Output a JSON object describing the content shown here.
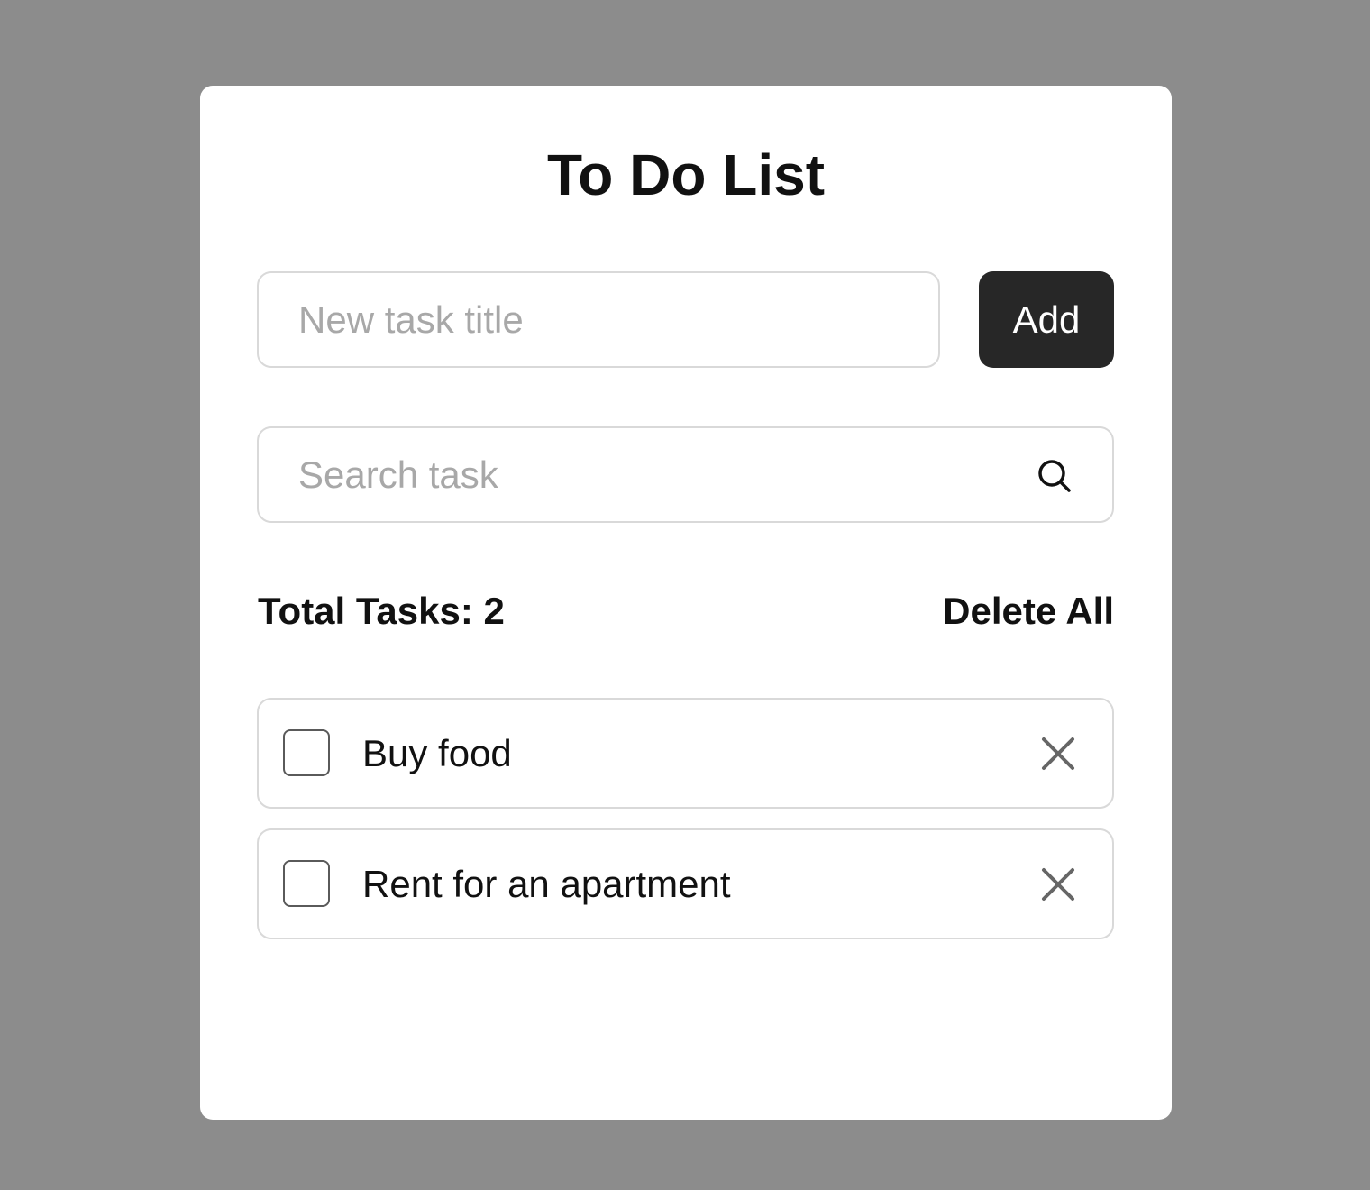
{
  "app": {
    "title": "To Do List"
  },
  "new_task": {
    "placeholder": "New task title",
    "value": "",
    "add_label": "Add"
  },
  "search": {
    "placeholder": "Search task",
    "value": "",
    "icon": "search-icon"
  },
  "summary": {
    "total_text": "Total Tasks: 2",
    "delete_all_label": "Delete All"
  },
  "tasks": [
    {
      "title": "Buy food",
      "done": false,
      "remove_icon": "close-icon"
    },
    {
      "title": "Rent for an apartment",
      "done": false,
      "remove_icon": "close-icon"
    }
  ],
  "colors": {
    "backdrop": "#8c8c8c",
    "card": "#ffffff",
    "button_bg": "#272727",
    "border": "#d9d9d9"
  }
}
